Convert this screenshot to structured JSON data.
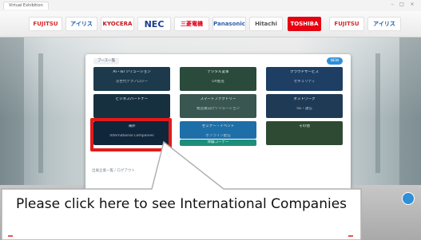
{
  "browser": {
    "tab_title": "Virtual Exhibition"
  },
  "sponsors": [
    {
      "name": "FUJITSU",
      "color": "#d6262b"
    },
    {
      "name": "アイリス",
      "color": "#1a5aa8"
    },
    {
      "name": "KYOCERA",
      "color": "#c4161c"
    },
    {
      "name": "NEC",
      "color": "#1a3c8f"
    },
    {
      "name": "三菱電機",
      "color": "#e2001a"
    },
    {
      "name": "Panasonic",
      "color": "#2f5fa9"
    },
    {
      "name": "Hitachi",
      "color": "#555555"
    },
    {
      "name": "TOSHIBA",
      "color": "#e60012"
    },
    {
      "name": "FUJITSU",
      "color": "#d6262b"
    },
    {
      "name": "アイリス",
      "color": "#1a5aa8"
    }
  ],
  "panel": {
    "tab_label": "ブース一覧",
    "badge_label": "NEW",
    "footer_text": "出展企業一覧 / ログアウト"
  },
  "tiles": [
    {
      "title": "AI・IoTソリューション",
      "sub": "次世代テクノロジー",
      "bg": "#1d3a4c"
    },
    {
      "title": "デジタル変革",
      "sub": "DX推進",
      "bg": "#2a4a3c"
    },
    {
      "title": "クラウドサービス",
      "sub": "セキュリティ",
      "bg": "#1e3f63"
    },
    {
      "title": "ビジネスパートナー",
      "sub": "",
      "bg": "#17303f"
    },
    {
      "title": "スマートファクトリー",
      "sub": "製造業向けソリューション",
      "bg": "#3a5650"
    },
    {
      "title": "ネットワーク",
      "sub": "5G・通信",
      "bg": "#1f3a55"
    },
    {
      "title": "海外",
      "sub": "International Companies",
      "bg": "#10263a"
    },
    {
      "title": "セミナー・イベント",
      "sub": "オンライン配信",
      "bg": "#1e6fa8"
    },
    {
      "title": "その他",
      "sub": "",
      "bg": "#2e4a33"
    }
  ],
  "tile_extra": {
    "bar_color": "#1c8f7a",
    "bar_label": "体験コーナー"
  },
  "callout": {
    "text": "Please click here to see International Companies",
    "border_color": "#b0b0b0",
    "accent": "#e21a1a"
  }
}
